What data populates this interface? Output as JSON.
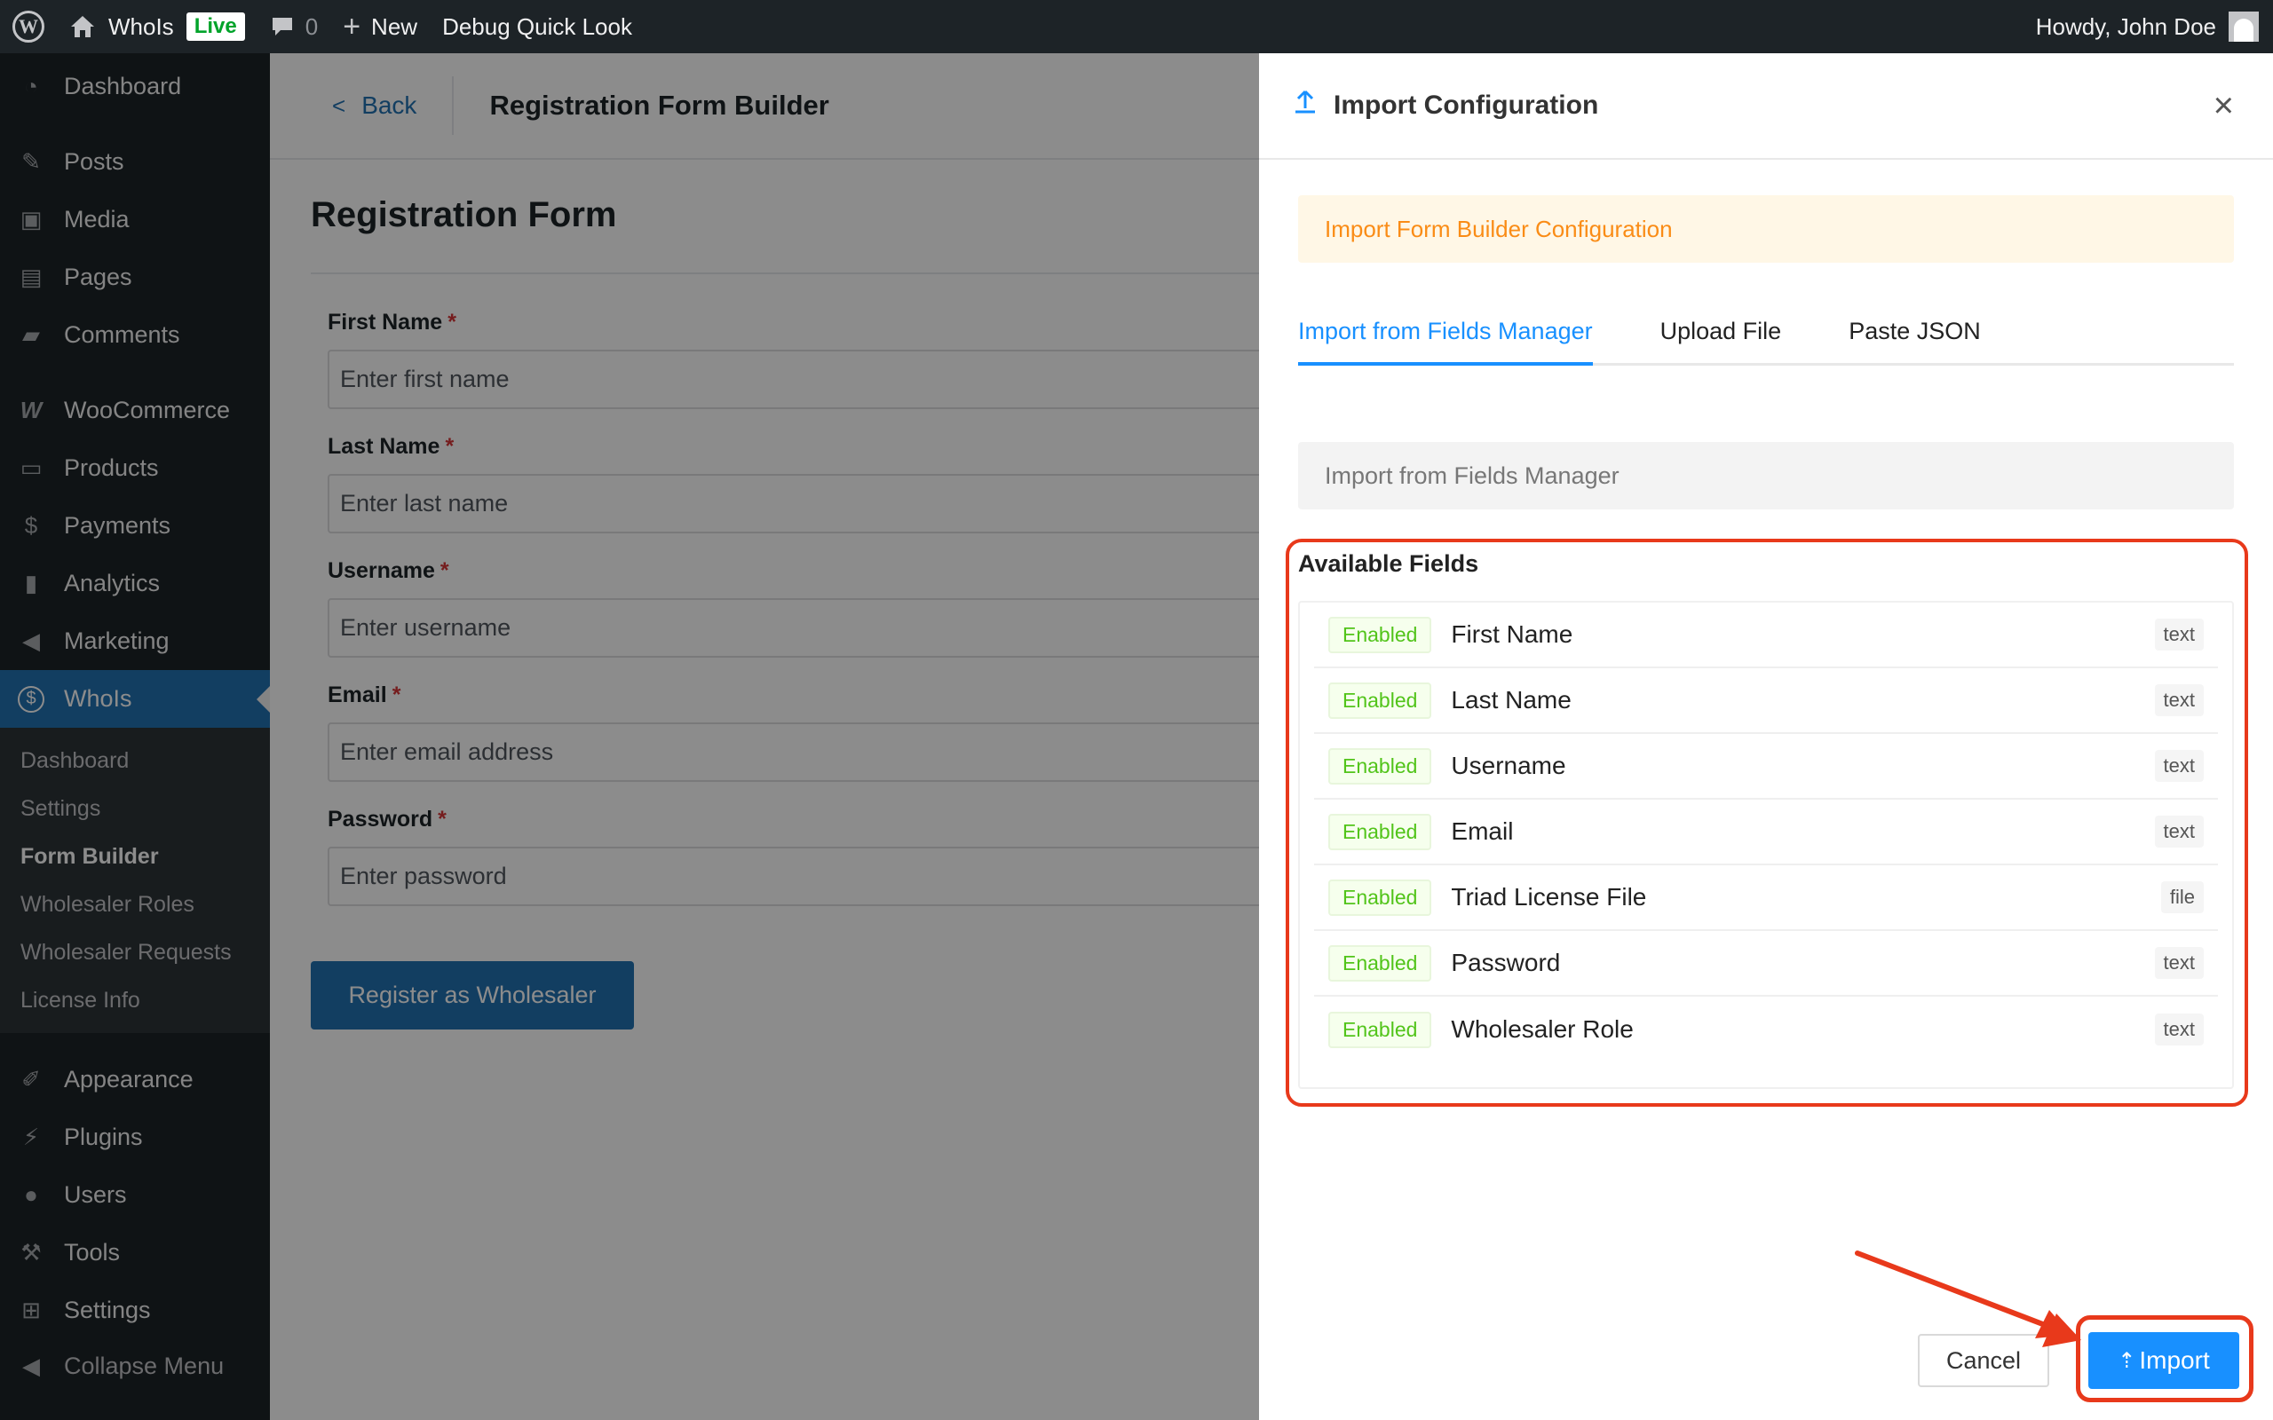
{
  "admin_bar": {
    "site_name": "WhoIs",
    "live_badge": "Live",
    "comments_count": "0",
    "new_label": "New",
    "debug_label": "Debug Quick Look",
    "greeting": "Howdy, John Doe"
  },
  "sidebar": {
    "items": [
      {
        "label": "Dashboard",
        "icon": "dashboard-icon"
      },
      {
        "label": "Posts",
        "icon": "pin-icon"
      },
      {
        "label": "Media",
        "icon": "media-icon"
      },
      {
        "label": "Pages",
        "icon": "pages-icon"
      },
      {
        "label": "Comments",
        "icon": "comment-icon"
      },
      {
        "label": "WooCommerce",
        "icon": "woocommerce-icon"
      },
      {
        "label": "Products",
        "icon": "archive-icon"
      },
      {
        "label": "Payments",
        "icon": "dollar-icon"
      },
      {
        "label": "Analytics",
        "icon": "bar-chart-icon"
      },
      {
        "label": "Marketing",
        "icon": "megaphone-icon"
      },
      {
        "label": "WhoIs",
        "icon": "dollar-circle-icon"
      },
      {
        "label": "Appearance",
        "icon": "brush-icon"
      },
      {
        "label": "Plugins",
        "icon": "plug-icon"
      },
      {
        "label": "Users",
        "icon": "user-icon"
      },
      {
        "label": "Tools",
        "icon": "wrench-icon"
      },
      {
        "label": "Settings",
        "icon": "settings-icon"
      },
      {
        "label": "Collapse Menu",
        "icon": "collapse-icon"
      }
    ],
    "submenu": [
      "Dashboard",
      "Settings",
      "Form Builder",
      "Wholesaler Roles",
      "Wholesaler Requests",
      "License Info"
    ]
  },
  "content": {
    "back_label": "Back",
    "page_title": "Registration Form Builder",
    "form_title": "Registration Form",
    "fields": [
      {
        "label": "First Name",
        "placeholder": "Enter first name"
      },
      {
        "label": "Last Name",
        "placeholder": "Enter last name"
      },
      {
        "label": "Username",
        "placeholder": "Enter username"
      },
      {
        "label": "Email",
        "placeholder": "Enter email address"
      },
      {
        "label": "Password",
        "placeholder": "Enter password"
      }
    ],
    "required_mark": "*",
    "submit_label": "Register as Wholesaler"
  },
  "drawer": {
    "title": "Import Configuration",
    "alert": "Import Form Builder Configuration",
    "tabs": [
      "Import from Fields Manager",
      "Upload File",
      "Paste JSON"
    ],
    "select_placeholder": "Import from Fields Manager",
    "available_title": "Available Fields",
    "fields": [
      {
        "status": "Enabled",
        "name": "First Name",
        "type": "text"
      },
      {
        "status": "Enabled",
        "name": "Last Name",
        "type": "text"
      },
      {
        "status": "Enabled",
        "name": "Username",
        "type": "text"
      },
      {
        "status": "Enabled",
        "name": "Email",
        "type": "text"
      },
      {
        "status": "Enabled",
        "name": "Triad License File",
        "type": "file"
      },
      {
        "status": "Enabled",
        "name": "Password",
        "type": "text"
      },
      {
        "status": "Enabled",
        "name": "Wholesaler Role",
        "type": "text"
      }
    ],
    "cancel_label": "Cancel",
    "import_label": "Import"
  },
  "colors": {
    "admin_dark": "#1d2327",
    "wp_blue": "#2271b1",
    "accent_blue": "#1890ff",
    "highlight_red": "#e8391b",
    "alert_orange": "#fa8c16",
    "enabled_green": "#52c41a"
  }
}
